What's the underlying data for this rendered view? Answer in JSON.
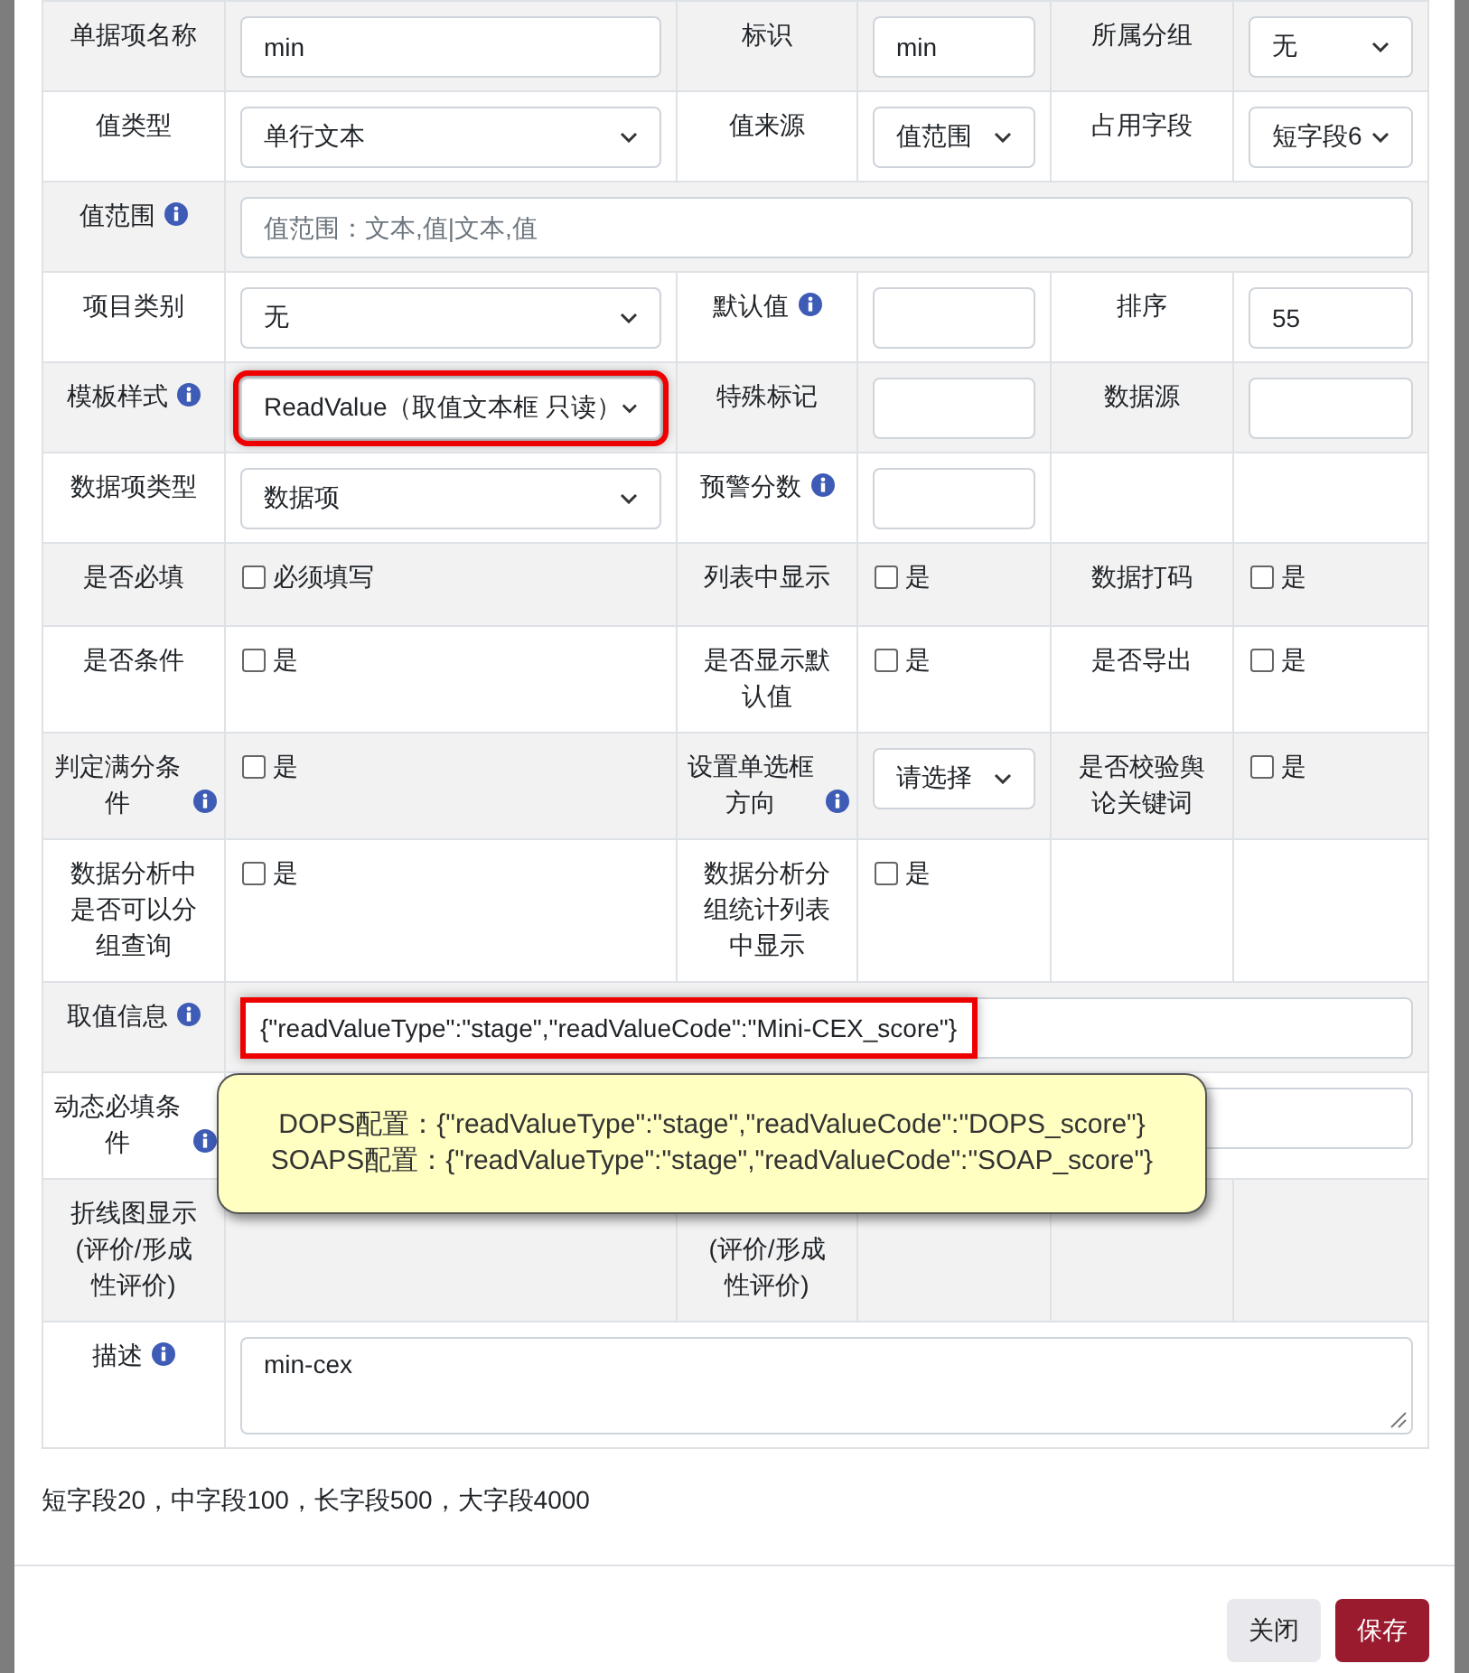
{
  "form": {
    "rows": [
      {
        "cells": [
          {
            "kind": "label",
            "text": "单据项名称"
          },
          {
            "kind": "input",
            "value": "min"
          },
          {
            "kind": "label",
            "text": "标识"
          },
          {
            "kind": "input",
            "value": "min"
          },
          {
            "kind": "label",
            "text": "所属分组"
          },
          {
            "kind": "select",
            "value": "无"
          }
        ]
      },
      {
        "cells": [
          {
            "kind": "label",
            "text": "值类型"
          },
          {
            "kind": "select",
            "value": "单行文本"
          },
          {
            "kind": "label",
            "text": "值来源"
          },
          {
            "kind": "select",
            "value": "值范围"
          },
          {
            "kind": "label",
            "text": "占用字段"
          },
          {
            "kind": "select",
            "value": "短字段6"
          }
        ]
      },
      {
        "cells": [
          {
            "kind": "label",
            "text": "值范围",
            "info": true
          },
          {
            "kind": "input",
            "placeholder": "值范围：文本,值|文本,值",
            "colspan": 5
          }
        ]
      },
      {
        "cells": [
          {
            "kind": "label",
            "text": "项目类别"
          },
          {
            "kind": "select",
            "value": "无"
          },
          {
            "kind": "label",
            "text": "默认值",
            "info": true
          },
          {
            "kind": "input"
          },
          {
            "kind": "label",
            "text": "排序"
          },
          {
            "kind": "input",
            "value": "55"
          }
        ]
      },
      {
        "cells": [
          {
            "kind": "label",
            "text": "模板样式",
            "info": true
          },
          {
            "kind": "select",
            "value": "ReadValue（取值文本框 只读）",
            "highlighted": true
          },
          {
            "kind": "label",
            "text": "特殊标记"
          },
          {
            "kind": "input"
          },
          {
            "kind": "label",
            "text": "数据源"
          },
          {
            "kind": "input"
          }
        ]
      },
      {
        "cells": [
          {
            "kind": "label",
            "text": "数据项类型"
          },
          {
            "kind": "select",
            "value": "数据项"
          },
          {
            "kind": "label",
            "text": "预警分数",
            "info": true
          },
          {
            "kind": "input"
          },
          {
            "kind": "empty"
          },
          {
            "kind": "empty"
          }
        ]
      },
      {
        "cells": [
          {
            "kind": "label",
            "text": "是否必填"
          },
          {
            "kind": "checkbox",
            "label": "必须填写",
            "checked": false
          },
          {
            "kind": "label",
            "text": "列表中显示"
          },
          {
            "kind": "checkbox",
            "label": "是",
            "checked": false
          },
          {
            "kind": "label",
            "text": "数据打码"
          },
          {
            "kind": "checkbox",
            "label": "是",
            "checked": false
          }
        ]
      },
      {
        "cells": [
          {
            "kind": "label",
            "text": "是否条件"
          },
          {
            "kind": "checkbox",
            "label": "是",
            "checked": false
          },
          {
            "kind": "label",
            "text": "是否显示默认值"
          },
          {
            "kind": "checkbox",
            "label": "是",
            "checked": false
          },
          {
            "kind": "label",
            "text": "是否导出"
          },
          {
            "kind": "checkbox",
            "label": "是",
            "checked": false
          }
        ]
      },
      {
        "cells": [
          {
            "kind": "label",
            "text": "判定满分条件",
            "info": true
          },
          {
            "kind": "checkbox",
            "label": "是",
            "checked": false
          },
          {
            "kind": "label",
            "text": "设置单选框方向",
            "info": true
          },
          {
            "kind": "select",
            "value": "请选择"
          },
          {
            "kind": "label",
            "text": "是否校验舆论关键词"
          },
          {
            "kind": "checkbox",
            "label": "是",
            "checked": false
          }
        ]
      },
      {
        "cells": [
          {
            "kind": "label",
            "text": "数据分析中是否可以分组查询"
          },
          {
            "kind": "checkbox",
            "label": "是",
            "checked": false
          },
          {
            "kind": "label",
            "text": "数据分析分组统计列表中显示"
          },
          {
            "kind": "checkbox",
            "label": "是",
            "checked": false
          },
          {
            "kind": "empty"
          },
          {
            "kind": "empty"
          }
        ]
      },
      {
        "cells": [
          {
            "kind": "label",
            "text": "取值信息",
            "info": true
          },
          {
            "kind": "input",
            "value": "{\"readValueType\":\"stage\",\"readValueCode\":\"Mini-CEX_score\"}",
            "highlighted": true,
            "colspan": 5
          }
        ]
      },
      {
        "cells": [
          {
            "kind": "label",
            "text": "动态必填条件",
            "info": true
          },
          {
            "kind": "input",
            "colspan": 5,
            "tooltip": {
              "lines": [
                "DOPS配置：{\"readValueType\":\"stage\",\"readValueCode\":\"DOPS_score\"}",
                "SOAPS配置：{\"readValueType\":\"stage\",\"readValueCode\":\"SOAP_score\"}"
              ]
            }
          }
        ]
      },
      {
        "covered": true,
        "cells": [
          {
            "kind": "label",
            "text": "折线图显示(评价/形成性评价)"
          },
          {
            "kind": "empty"
          },
          {
            "kind": "label",
            "text": "(评价/形成性评价)"
          },
          {
            "kind": "empty"
          },
          {
            "kind": "empty"
          },
          {
            "kind": "empty"
          }
        ]
      },
      {
        "cells": [
          {
            "kind": "label",
            "text": "描述",
            "info": true
          },
          {
            "kind": "textarea",
            "value": "min-cex",
            "colspan": 5
          }
        ]
      }
    ]
  },
  "note": "短字段20，中字段100，长字段500，大字段4000",
  "buttons": [
    {
      "label": "关闭",
      "kind": "secondary"
    },
    {
      "label": "保存",
      "kind": "primary"
    }
  ]
}
